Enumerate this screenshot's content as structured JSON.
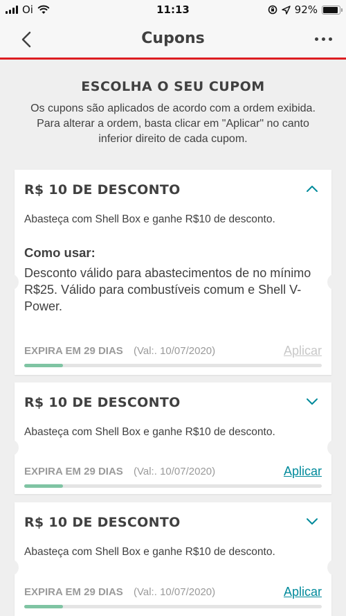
{
  "status_bar": {
    "carrier": "Oi",
    "time": "11:13",
    "battery_percent": "92%",
    "battery_level": 0.92
  },
  "nav": {
    "title": "Cupons",
    "back_icon": "chevron-left-icon",
    "more_icon": "more-horizontal-icon"
  },
  "intro": {
    "heading": "ESCOLHA O SEU CUPOM",
    "text": "Os cupons são aplicados de acordo com a ordem exibida. Para alterar a ordem, basta clicar em \"Aplicar\" no canto inferior direito de cada cupom."
  },
  "colors": {
    "accent_red": "#dd1d21",
    "teal": "#008a9b",
    "progress_green": "#7fc4a3",
    "disabled_gray": "#c8c8c8"
  },
  "coupons": [
    {
      "title": "R$ 10 DE DESCONTO",
      "description": "Abasteça com Shell Box e ganhe R$10 de desconto.",
      "expanded": true,
      "how_to_label": "Como usar:",
      "how_to_text": "Desconto válido para abastecimentos de no mínimo R$25. Válido para combustíveis comum e Shell V-Power.",
      "expires": "EXPIRA EM 29 DIAS",
      "validity": "(Val:. 10/07/2020)",
      "apply_label": "Aplicar",
      "apply_enabled": false,
      "progress": 0.13
    },
    {
      "title": "R$ 10 DE DESCONTO",
      "description": "Abasteça com Shell Box e ganhe R$10 de desconto.",
      "expanded": false,
      "expires": "EXPIRA EM 29 DIAS",
      "validity": "(Val:. 10/07/2020)",
      "apply_label": "Aplicar",
      "apply_enabled": true,
      "progress": 0.13
    },
    {
      "title": "R$ 10 DE DESCONTO",
      "description": "Abasteça com Shell Box e ganhe R$10 de desconto.",
      "expanded": false,
      "expires": "EXPIRA EM 29 DIAS",
      "validity": "(Val:. 10/07/2020)",
      "apply_label": "Aplicar",
      "apply_enabled": true,
      "progress": 0.13
    }
  ]
}
